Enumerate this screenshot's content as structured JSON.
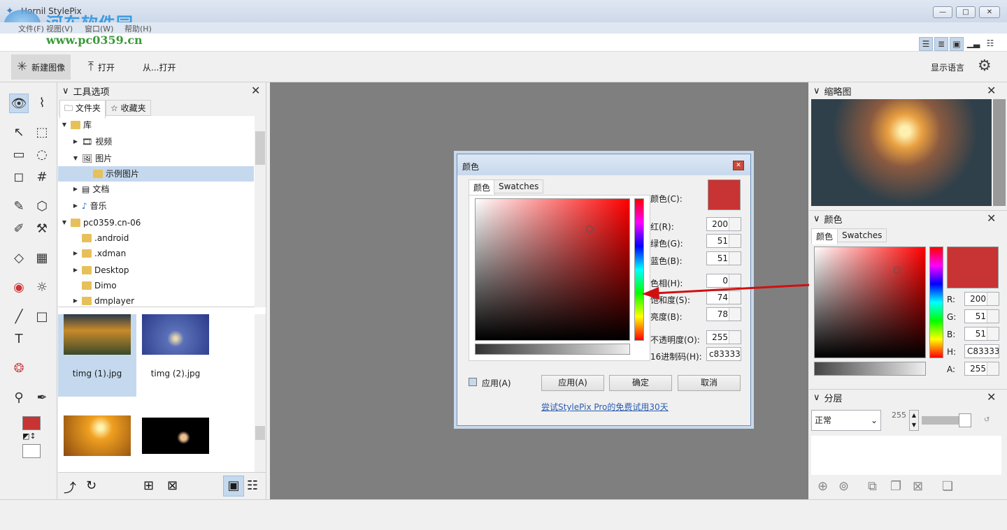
{
  "app": {
    "title": "Hornil StylePix"
  },
  "watermark": {
    "brand": "河东软件园",
    "url": "www.pc0359.cn"
  },
  "window_controls": {
    "minimize": "—",
    "maximize": "□",
    "close": "✕"
  },
  "menu": [
    "文件(F)",
    "视图(V)",
    "窗口(W)",
    "帮助(H)"
  ],
  "toolbar": {
    "new_image": "新建图像",
    "open": "打开",
    "open_from": "从...打开",
    "language": "显示语言"
  },
  "tool_options": {
    "title": "工具选项",
    "tab_folder": "文件夹",
    "tab_favorites": "收藏夹"
  },
  "tree": [
    {
      "label": "库"
    },
    {
      "label": "视频"
    },
    {
      "label": "图片"
    },
    {
      "label": "示例图片"
    },
    {
      "label": "文档"
    },
    {
      "label": "音乐"
    },
    {
      "label": "pc0359.cn-06"
    },
    {
      "label": ".android"
    },
    {
      "label": ".xdman"
    },
    {
      "label": "Desktop"
    },
    {
      "label": "Dimo"
    },
    {
      "label": "dmplayer"
    }
  ],
  "thumbnails": [
    {
      "name": "timg (1).jpg"
    },
    {
      "name": "timg (2).jpg"
    }
  ],
  "dialog": {
    "title": "颜色",
    "tab_color": "颜色",
    "tab_swatches": "Swatches",
    "color_label": "颜色(C):",
    "red_label": "红(R):",
    "red": "200",
    "green_label": "绿色(G):",
    "green": "51",
    "blue_label": "蓝色(B):",
    "blue": "51",
    "hue_label": "色相(H):",
    "hue": "0",
    "sat_label": "饱和度(S):",
    "sat": "74",
    "val_label": "亮度(B):",
    "val": "78",
    "alpha_label": "不透明度(O):",
    "alpha": "255",
    "hex_label": "16进制码(H):",
    "hex": "c83333",
    "apply_check": "应用(A)",
    "apply_btn": "应用(A)",
    "ok_btn": "确定",
    "cancel_btn": "取消",
    "promo": "尝试StylePix Pro的免费试用30天"
  },
  "colors": {
    "current": "#c83333",
    "accent": "#c5d9ee",
    "canvas": "#7f7f7f"
  },
  "right": {
    "thumbnail_title": "缩略图",
    "color_title": "颜色",
    "tab_color": "颜色",
    "tab_swatches": "Swatches",
    "r_label": "R:",
    "r": "200",
    "g_label": "G:",
    "g": "51",
    "b_label": "B:",
    "b": "51",
    "h_label": "H:",
    "h": "C83333",
    "a_label": "A:",
    "a": "255",
    "layers_title": "分层",
    "blend": "正常",
    "opacity": "255"
  }
}
